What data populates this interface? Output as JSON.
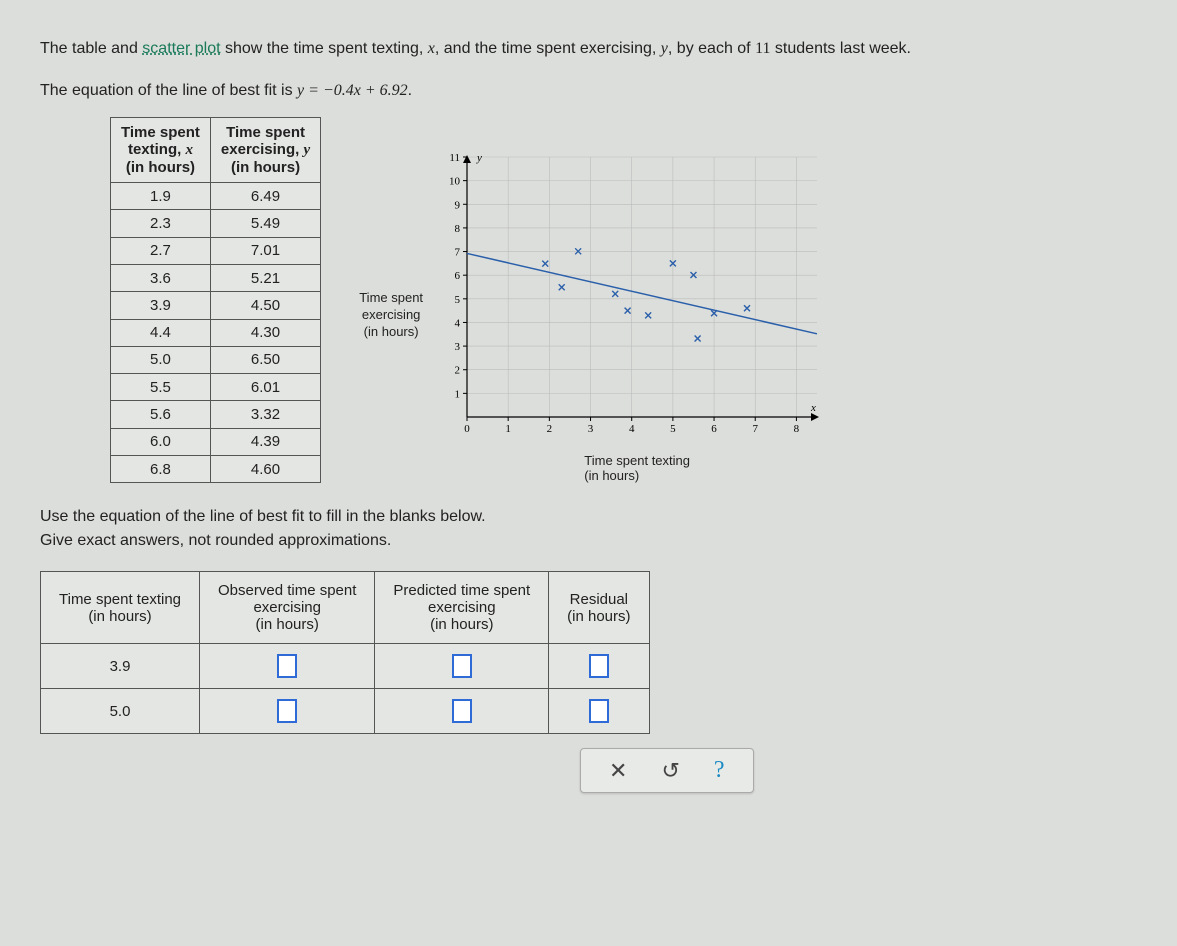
{
  "intro1_a": "The table and ",
  "intro1_link": "scatter plot",
  "intro1_b": " show the time spent texting, ",
  "intro1_c": ", and the time spent exercising, ",
  "intro1_d": ", by each of ",
  "intro1_n": "11",
  "intro1_e": " students last week.",
  "intro2_a": "The equation of the line of best fit is ",
  "intro2_eq": "y = −0.4x + 6.92",
  "intro2_b": ".",
  "data_table": {
    "h1a": "Time spent",
    "h1b": "texting, ",
    "h1c": "x",
    "h1d": "(in hours)",
    "h2a": "Time spent",
    "h2b": "exercising, ",
    "h2c": "y",
    "h2d": "(in hours)",
    "rows": [
      {
        "x": "1.9",
        "y": "6.49"
      },
      {
        "x": "2.3",
        "y": "5.49"
      },
      {
        "x": "2.7",
        "y": "7.01"
      },
      {
        "x": "3.6",
        "y": "5.21"
      },
      {
        "x": "3.9",
        "y": "4.50"
      },
      {
        "x": "4.4",
        "y": "4.30"
      },
      {
        "x": "5.0",
        "y": "6.50"
      },
      {
        "x": "5.5",
        "y": "6.01"
      },
      {
        "x": "5.6",
        "y": "3.32"
      },
      {
        "x": "6.0",
        "y": "4.39"
      },
      {
        "x": "6.8",
        "y": "4.60"
      }
    ]
  },
  "chart_data": {
    "type": "scatter",
    "title": "",
    "xlabel": "Time spent texting\n(in hours)",
    "ylabel": "Time spent\nexercising\n(in hours)",
    "xlim": [
      0,
      8.5
    ],
    "ylim": [
      0,
      11
    ],
    "xticks": [
      0,
      1,
      2,
      3,
      4,
      5,
      6,
      7,
      8
    ],
    "yticks": [
      1,
      2,
      3,
      4,
      5,
      6,
      7,
      8,
      9,
      10,
      11
    ],
    "points": [
      {
        "x": 1.9,
        "y": 6.49
      },
      {
        "x": 2.3,
        "y": 5.49
      },
      {
        "x": 2.7,
        "y": 7.01
      },
      {
        "x": 3.6,
        "y": 5.21
      },
      {
        "x": 3.9,
        "y": 4.5
      },
      {
        "x": 4.4,
        "y": 4.3
      },
      {
        "x": 5.0,
        "y": 6.5
      },
      {
        "x": 5.5,
        "y": 6.01
      },
      {
        "x": 5.6,
        "y": 3.32
      },
      {
        "x": 6.0,
        "y": 4.39
      },
      {
        "x": 6.8,
        "y": 4.6
      }
    ],
    "fit_line": {
      "m": -0.4,
      "b": 6.92,
      "x0": 0,
      "x1": 8.5
    },
    "x_axis_glyph": "x",
    "y_axis_glyph": "y"
  },
  "instr1": "Use the equation of the line of best fit to fill in the blanks below.",
  "instr2": "Give exact answers, not rounded approximations.",
  "answer_table": {
    "h1": "Time spent texting\n(in hours)",
    "h2": "Observed time spent\nexercising\n(in hours)",
    "h3": "Predicted time spent\nexercising\n(in hours)",
    "h4": "Residual\n(in hours)",
    "rows": [
      {
        "x": "3.9"
      },
      {
        "x": "5.0"
      }
    ]
  },
  "toolbar": {
    "clear": "✕",
    "reset": "↺",
    "help": "?"
  }
}
